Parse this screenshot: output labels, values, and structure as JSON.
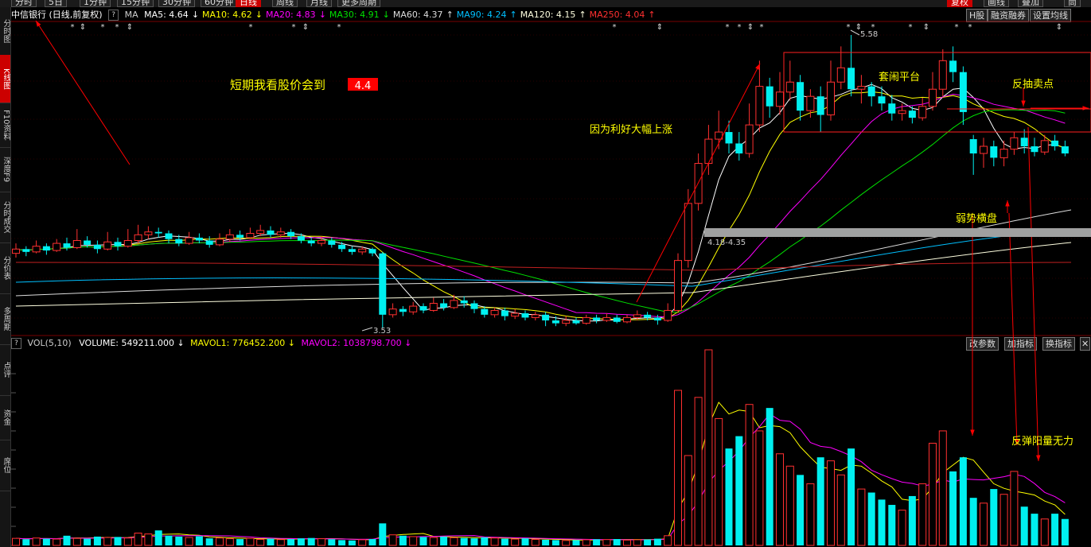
{
  "top_menu": {
    "items": [
      "分时",
      "5日",
      "1分钟",
      "15分钟",
      "30分钟",
      "60分钟",
      "日线",
      "周线",
      "月线",
      "更多周期"
    ],
    "active": 6,
    "right_items": [
      "复权",
      "画线",
      "叠加",
      "筒"
    ],
    "right_active": 0
  },
  "left_tabs": [
    {
      "label": "分时图",
      "active": false
    },
    {
      "label": "K线图",
      "active": true
    },
    {
      "label": "F10资料",
      "active": false
    },
    {
      "label": "深度F9",
      "active": false
    },
    {
      "label": "分时成交",
      "active": false
    },
    {
      "label": "分价表",
      "active": false
    },
    {
      "label": "多周期",
      "active": false
    },
    {
      "label": "点评",
      "active": false
    },
    {
      "label": "资金",
      "active": false
    },
    {
      "label": "席位",
      "active": false
    }
  ],
  "price_panel": {
    "title": "中信银行 (日线,前复权)",
    "help": "?",
    "indicator": "MA",
    "ma": [
      {
        "label": "MA5: 4.64",
        "arrow": "↓",
        "color": "#ffffff"
      },
      {
        "label": "MA10: 4.62",
        "arrow": "↓",
        "color": "#ffff00"
      },
      {
        "label": "MA20: 4.83",
        "arrow": "↓",
        "color": "#ff00ff"
      },
      {
        "label": "MA30: 4.91",
        "arrow": "↓",
        "color": "#00e000"
      },
      {
        "label": "MA60: 4.37",
        "arrow": "↑",
        "color": "#dddddd"
      },
      {
        "label": "MA90: 4.24",
        "arrow": "↑",
        "color": "#00c0ff"
      },
      {
        "label": "MA120: 4.15",
        "arrow": "↑",
        "color": "#ffffe0"
      },
      {
        "label": "MA250: 4.04",
        "arrow": "↑",
        "color": "#ff3030"
      }
    ],
    "buttons": [
      "H股",
      "融资融券",
      "设置均线"
    ],
    "labels": {
      "high": "5.58",
      "low": "3.53",
      "zone": "4.18-4.35",
      "target_text": "短期我看股价会到",
      "target_value": "4.4",
      "rally": "因为利好大幅上涨",
      "platform": "套闹平台",
      "sell": "反抽卖点",
      "weak": "弱势横盘"
    }
  },
  "volume_panel": {
    "help": "?",
    "title": "VOL(5,10)",
    "volume": "VOLUME: 549211.000",
    "volume_arrow": "↓",
    "mavol1": "MAVOL1: 776452.200",
    "mavol1_arrow": "↓",
    "mavol2": "MAVOL2: 1038798.700",
    "mavol2_arrow": "↓",
    "buttons": [
      "改参数",
      "加指标",
      "换指标"
    ],
    "close": "✕",
    "label_rebound": "反弹阳量无力"
  },
  "chart_data": {
    "type": "candlestick",
    "series": [
      {
        "name": "MA5",
        "values": [
          4.64
        ]
      },
      {
        "name": "MA10",
        "values": [
          4.62
        ]
      },
      {
        "name": "MA20",
        "values": [
          4.83
        ]
      },
      {
        "name": "MA30",
        "values": [
          4.91
        ]
      },
      {
        "name": "MA60",
        "values": [
          4.37
        ]
      },
      {
        "name": "MA90",
        "values": [
          4.24
        ]
      },
      {
        "name": "MA120",
        "values": [
          4.15
        ]
      },
      {
        "name": "MA250",
        "values": [
          4.04
        ]
      }
    ],
    "colors": {
      "up": "#ff3030",
      "down": "#00f0f0",
      "bg": "#000000",
      "grid": "#400000"
    },
    "price_high": 5.58,
    "price_low": 3.53,
    "candles": [
      [
        4.05,
        4.08,
        4.12,
        4.02
      ],
      [
        4.08,
        4.06,
        4.1,
        4.03
      ],
      [
        4.06,
        4.1,
        4.14,
        4.05
      ],
      [
        4.1,
        4.07,
        4.12,
        4.04
      ],
      [
        4.07,
        4.12,
        4.15,
        4.06
      ],
      [
        4.12,
        4.09,
        4.16,
        4.07
      ],
      [
        4.09,
        4.14,
        4.22,
        4.08
      ],
      [
        4.14,
        4.11,
        4.17,
        4.09
      ],
      [
        4.11,
        4.08,
        4.14,
        4.05
      ],
      [
        4.08,
        4.13,
        4.2,
        4.07
      ],
      [
        4.13,
        4.1,
        4.16,
        4.07
      ],
      [
        4.1,
        4.14,
        4.22,
        4.09
      ],
      [
        4.14,
        4.18,
        4.25,
        4.12
      ],
      [
        4.18,
        4.2,
        4.24,
        4.15
      ],
      [
        4.2,
        4.19,
        4.23,
        4.16
      ],
      [
        4.19,
        4.15,
        4.21,
        4.12
      ],
      [
        4.15,
        4.12,
        4.18,
        4.1
      ],
      [
        4.12,
        4.16,
        4.2,
        4.11
      ],
      [
        4.16,
        4.14,
        4.19,
        4.12
      ],
      [
        4.14,
        4.11,
        4.17,
        4.09
      ],
      [
        4.11,
        4.15,
        4.19,
        4.1
      ],
      [
        4.15,
        4.18,
        4.22,
        4.13
      ],
      [
        4.18,
        4.16,
        4.21,
        4.14
      ],
      [
        4.16,
        4.19,
        4.23,
        4.15
      ],
      [
        4.19,
        4.21,
        4.25,
        4.17
      ],
      [
        4.21,
        4.18,
        4.24,
        4.16
      ],
      [
        4.18,
        4.2,
        4.23,
        4.16
      ],
      [
        4.2,
        4.17,
        4.22,
        4.15
      ],
      [
        4.17,
        4.14,
        4.19,
        4.12
      ],
      [
        4.14,
        4.12,
        4.16,
        4.1
      ],
      [
        4.12,
        4.14,
        4.17,
        4.1
      ],
      [
        4.14,
        4.11,
        4.16,
        4.09
      ],
      [
        4.11,
        4.08,
        4.13,
        4.06
      ],
      [
        4.08,
        4.06,
        4.1,
        4.04
      ],
      [
        4.06,
        4.08,
        4.1,
        4.04
      ],
      [
        4.08,
        4.05,
        4.09,
        4.03
      ],
      [
        4.05,
        3.62,
        4.06,
        3.53
      ],
      [
        3.62,
        3.66,
        3.7,
        3.6
      ],
      [
        3.66,
        3.64,
        3.68,
        3.61
      ],
      [
        3.64,
        3.68,
        3.71,
        3.62
      ],
      [
        3.68,
        3.65,
        3.7,
        3.63
      ],
      [
        3.65,
        3.7,
        3.74,
        3.64
      ],
      [
        3.7,
        3.67,
        3.73,
        3.65
      ],
      [
        3.67,
        3.72,
        3.76,
        3.66
      ],
      [
        3.72,
        3.7,
        3.75,
        3.67
      ],
      [
        3.7,
        3.66,
        3.72,
        3.63
      ],
      [
        3.66,
        3.62,
        3.68,
        3.6
      ],
      [
        3.62,
        3.65,
        3.67,
        3.6
      ],
      [
        3.65,
        3.61,
        3.67,
        3.58
      ],
      [
        3.61,
        3.63,
        3.66,
        3.59
      ],
      [
        3.63,
        3.6,
        3.65,
        3.58
      ],
      [
        3.6,
        3.62,
        3.64,
        3.58
      ],
      [
        3.62,
        3.58,
        3.64,
        3.54
      ],
      [
        3.58,
        3.56,
        3.61,
        3.54
      ],
      [
        3.56,
        3.58,
        3.61,
        3.54
      ],
      [
        3.58,
        3.56,
        3.6,
        3.55
      ],
      [
        3.56,
        3.6,
        3.62,
        3.55
      ],
      [
        3.6,
        3.58,
        3.62,
        3.56
      ],
      [
        3.58,
        3.6,
        3.63,
        3.57
      ],
      [
        3.6,
        3.57,
        3.62,
        3.56
      ],
      [
        3.57,
        3.6,
        3.62,
        3.56
      ],
      [
        3.6,
        3.62,
        3.65,
        3.58
      ],
      [
        3.62,
        3.6,
        3.64,
        3.58
      ],
      [
        3.6,
        3.58,
        3.62,
        3.55
      ],
      [
        3.58,
        3.65,
        3.7,
        3.57
      ],
      [
        3.65,
        4.0,
        4.05,
        3.63
      ],
      [
        4.0,
        4.4,
        4.5,
        3.95
      ],
      [
        4.4,
        4.68,
        4.75,
        4.35
      ],
      [
        4.68,
        4.85,
        4.95,
        4.6
      ],
      [
        4.85,
        4.9,
        5.05,
        4.78
      ],
      [
        4.9,
        4.82,
        4.98,
        4.75
      ],
      [
        4.82,
        4.75,
        4.9,
        4.7
      ],
      [
        4.75,
        4.95,
        5.1,
        4.72
      ],
      [
        4.95,
        5.22,
        5.4,
        4.9
      ],
      [
        5.22,
        5.08,
        5.28,
        5.0
      ],
      [
        5.08,
        5.18,
        5.32,
        5.02
      ],
      [
        5.18,
        5.25,
        5.4,
        5.12
      ],
      [
        5.25,
        5.05,
        5.3,
        4.98
      ],
      [
        5.05,
        5.15,
        5.2,
        5.0
      ],
      [
        5.15,
        5.02,
        5.22,
        4.9
      ],
      [
        5.02,
        5.25,
        5.4,
        4.98
      ],
      [
        5.25,
        5.35,
        5.5,
        5.2
      ],
      [
        5.35,
        5.2,
        5.58,
        5.15
      ],
      [
        5.2,
        5.22,
        5.3,
        5.1
      ],
      [
        5.22,
        5.15,
        5.25,
        5.08
      ],
      [
        5.15,
        5.1,
        5.22,
        5.05
      ],
      [
        5.1,
        5.03,
        5.16,
        4.98
      ],
      [
        5.03,
        5.05,
        5.1,
        4.98
      ],
      [
        5.05,
        5.0,
        5.08,
        4.96
      ],
      [
        5.0,
        5.08,
        5.14,
        4.98
      ],
      [
        5.08,
        5.2,
        5.32,
        5.05
      ],
      [
        5.2,
        5.4,
        5.48,
        5.15
      ],
      [
        5.4,
        5.32,
        5.5,
        5.25
      ],
      [
        5.32,
        5.04,
        5.36,
        4.95
      ],
      [
        4.85,
        4.75,
        4.88,
        4.6
      ],
      [
        4.75,
        4.8,
        4.86,
        4.65
      ],
      [
        4.8,
        4.72,
        4.84,
        4.66
      ],
      [
        4.72,
        4.78,
        4.84,
        4.66
      ],
      [
        4.78,
        4.86,
        4.9,
        4.74
      ],
      [
        4.86,
        4.8,
        4.92,
        4.75
      ],
      [
        4.8,
        4.76,
        4.86,
        4.73
      ],
      [
        4.76,
        4.84,
        4.88,
        4.74
      ],
      [
        4.84,
        4.8,
        4.88,
        4.77
      ],
      [
        4.8,
        4.75,
        4.84,
        4.73
      ]
    ],
    "volumes": [
      0.4,
      0.35,
      0.42,
      0.38,
      0.36,
      0.55,
      0.4,
      0.38,
      0.5,
      0.45,
      0.48,
      0.42,
      0.7,
      0.65,
      0.85,
      0.55,
      0.5,
      0.45,
      0.52,
      0.4,
      0.42,
      0.38,
      0.36,
      0.4,
      0.34,
      0.38,
      0.33,
      0.36,
      0.4,
      0.42,
      0.38,
      0.35,
      0.3,
      0.28,
      0.32,
      0.36,
      1.25,
      0.6,
      0.55,
      0.5,
      0.48,
      0.45,
      0.5,
      0.44,
      0.42,
      0.4,
      0.46,
      0.42,
      0.38,
      0.36,
      0.4,
      0.34,
      0.32,
      0.3,
      0.28,
      0.3,
      0.32,
      0.35,
      0.33,
      0.36,
      0.3,
      0.32,
      0.34,
      0.38,
      0.55,
      8.8,
      5.1,
      8.4,
      11.1,
      7.2,
      5.5,
      6.2,
      8.0,
      6.5,
      7.8,
      5.2,
      4.5,
      4.0,
      3.5,
      5.0,
      4.8,
      4.0,
      5.5,
      3.2,
      3.0,
      2.6,
      2.3,
      2.0,
      2.8,
      3.5,
      5.8,
      6.5,
      4.2,
      5.0,
      2.7,
      2.4,
      3.2,
      2.9,
      4.2,
      2.2,
      1.8,
      1.5,
      1.8,
      1.5
    ]
  }
}
